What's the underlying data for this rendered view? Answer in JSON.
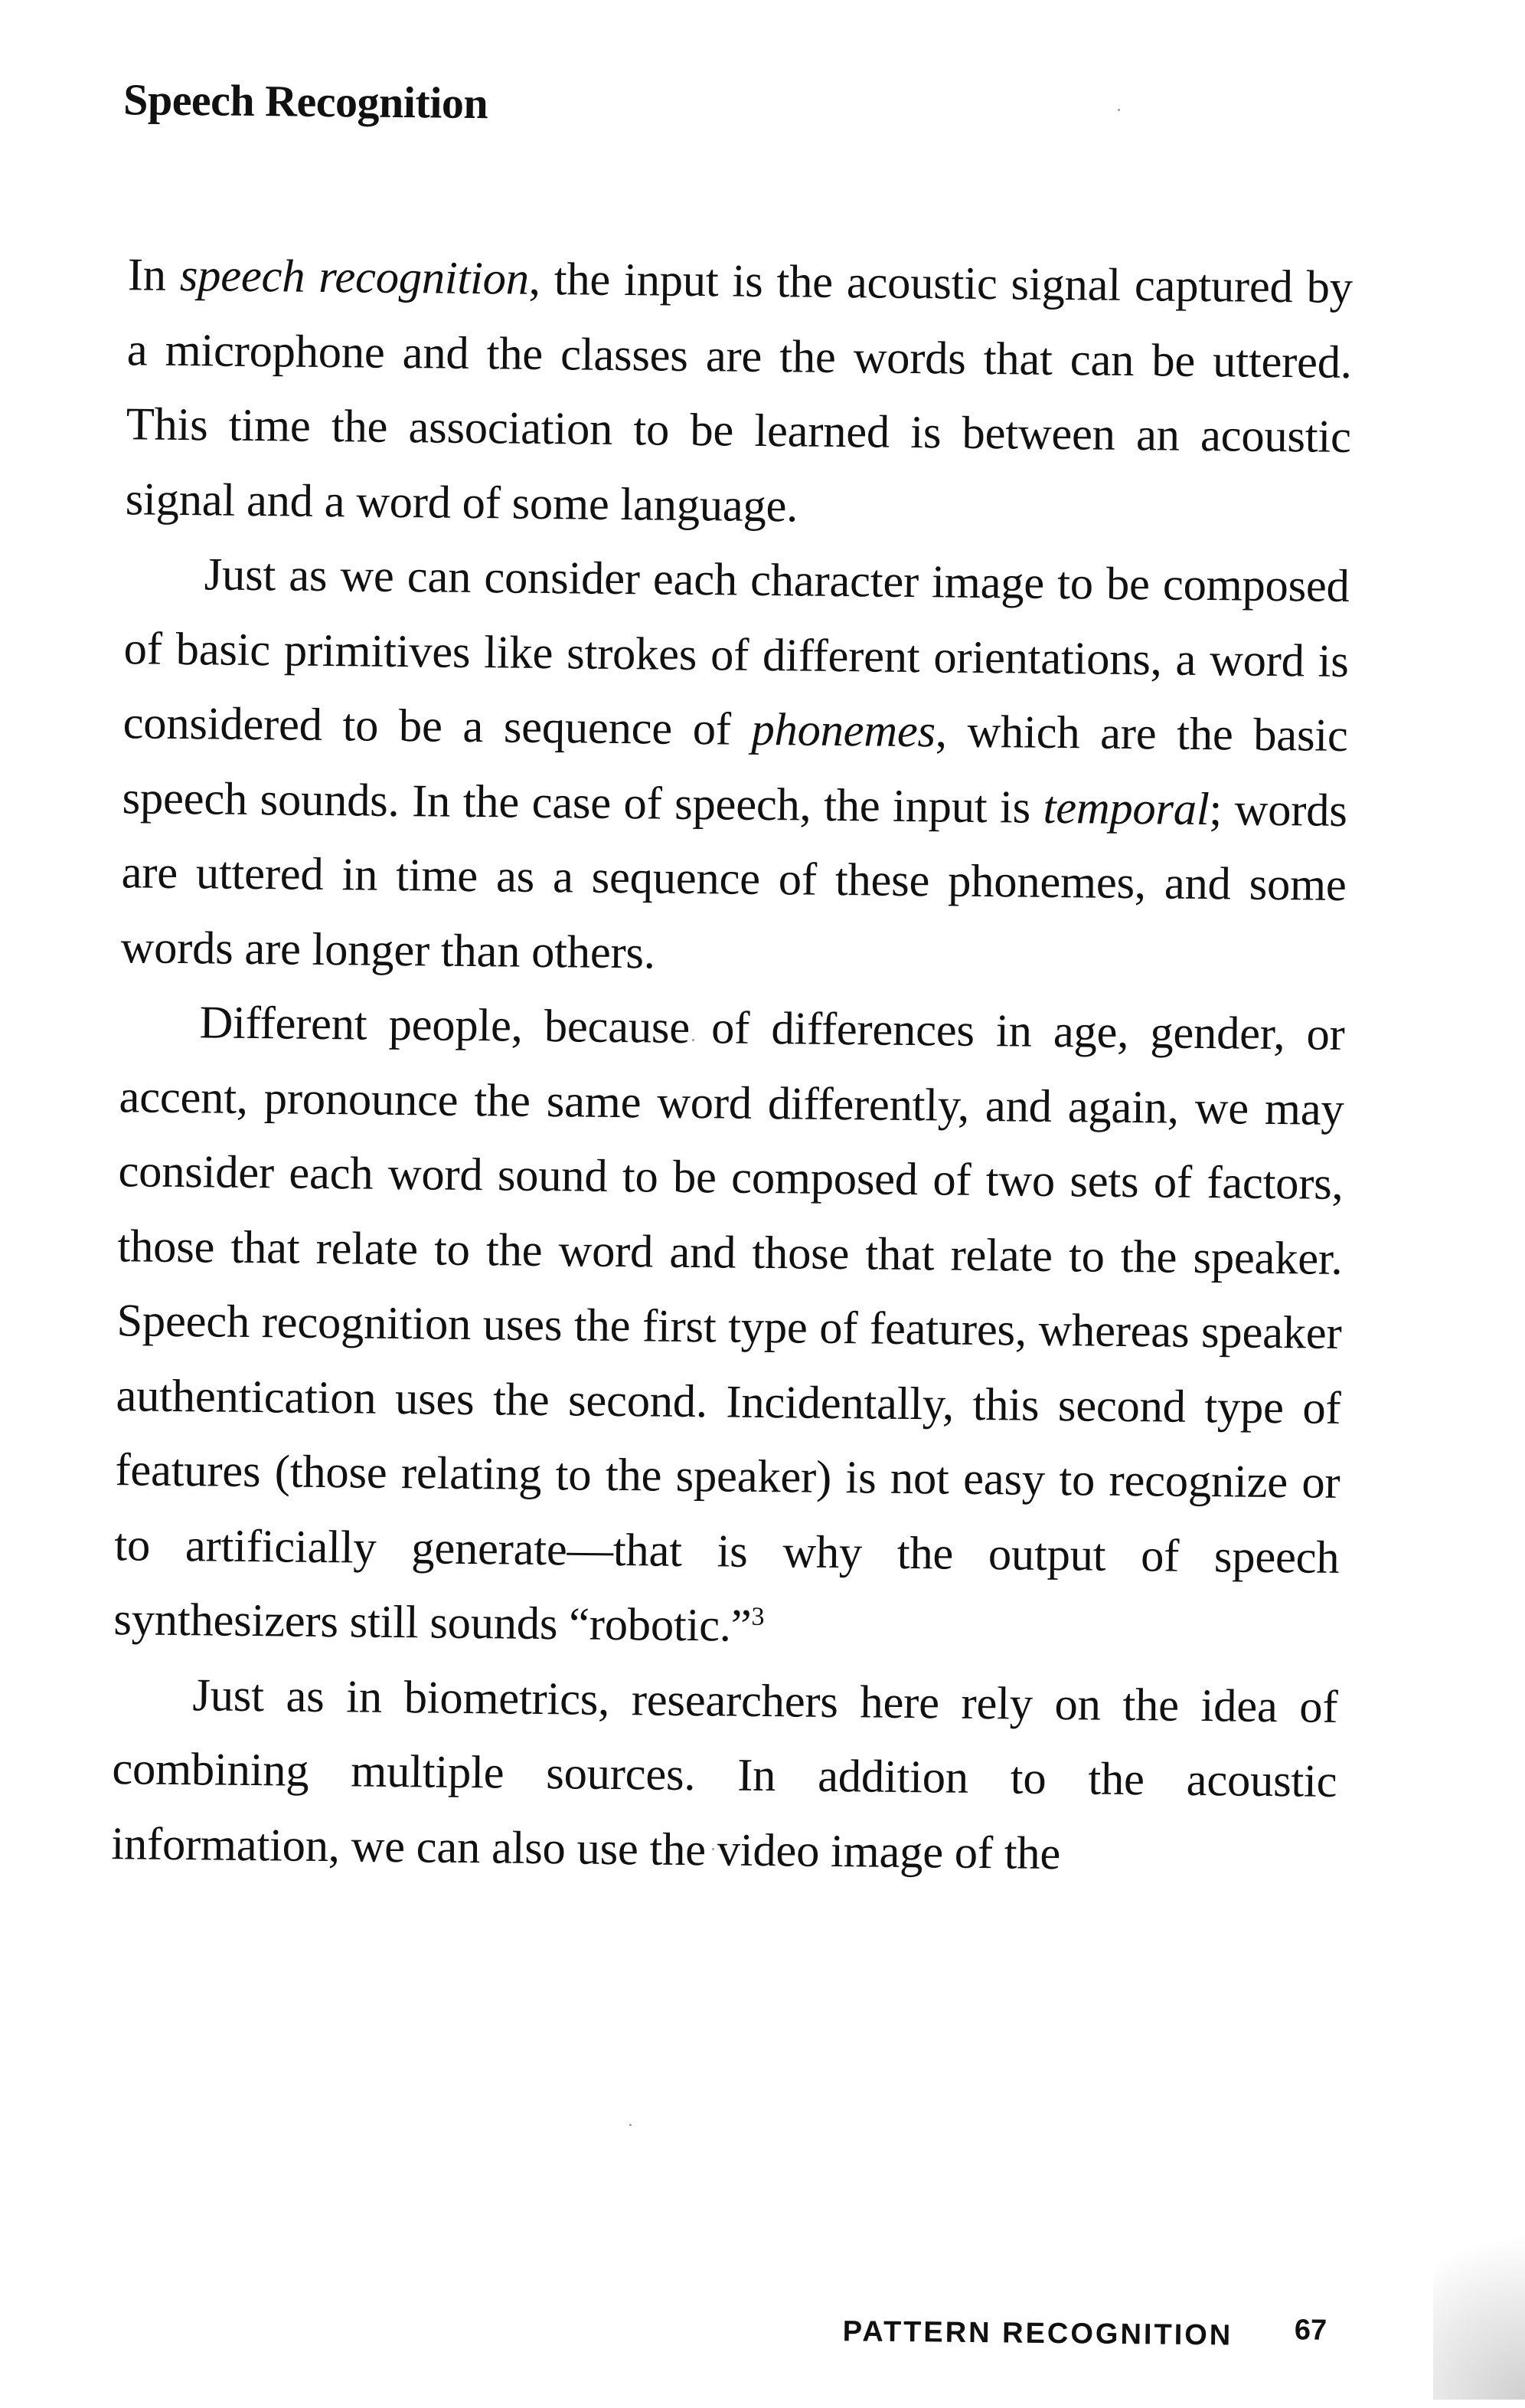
{
  "heading": "Speech Recognition",
  "paragraphs": [
    [
      {
        "t": "In "
      },
      {
        "t": "speech recognition",
        "i": true
      },
      {
        "t": ", the input is the acoustic signal captured by a microphone and the classes are the words that can be uttered. This time the association to be learned is between an acoustic signal and a word of some language."
      }
    ],
    [
      {
        "t": "Just as we can consider each character image to be composed of basic primitives like strokes of different orientations, a word is considered to be a sequence of "
      },
      {
        "t": "phonemes",
        "i": true
      },
      {
        "t": ", which are the basic speech sounds. In the case of speech, the input is "
      },
      {
        "t": "temporal",
        "i": true
      },
      {
        "t": "; words are uttered in time as a sequence of these phonemes, and some words are longer than others."
      }
    ],
    [
      {
        "t": "Different people, because of differences in age, gender, or accent, pronounce the same word differently, and again, we may consider each word sound to be composed of two sets of factors, those that relate to the word and those that relate to the speaker. Speech recognition uses the first type of features, whereas speaker authentication uses the second. Incidentally, this second type of features (those relating to the speaker) is not easy to recognize or to artificially generate—that is why the output of speech synthesizers still sounds “robotic.”"
      },
      {
        "t": "3",
        "sup": true
      }
    ],
    [
      {
        "t": "Just as in biometrics, researchers here rely on the idea of combining multiple sources. In addition to the acoustic information, we can also use the video image of the"
      }
    ]
  ],
  "footer": {
    "running_title": "PATTERN RECOGNITION",
    "page_number": "67"
  }
}
